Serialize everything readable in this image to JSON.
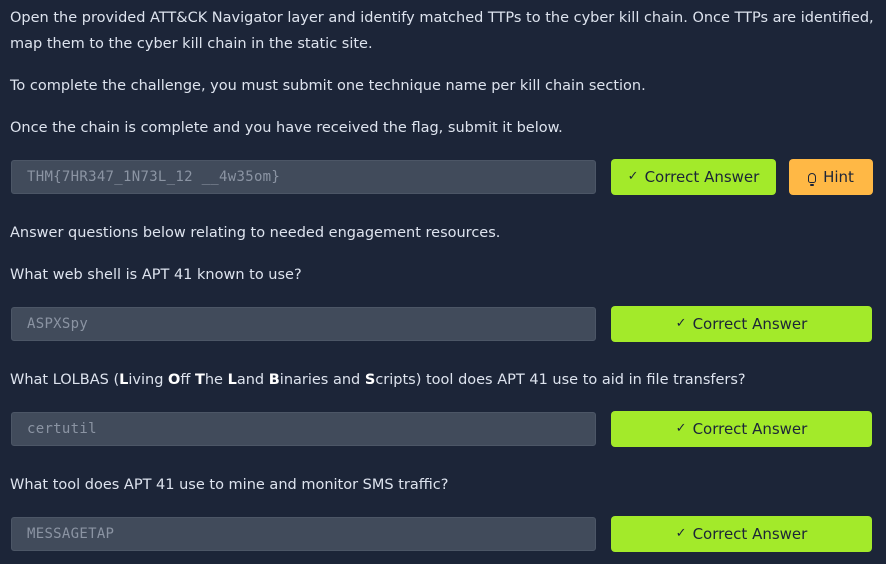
{
  "intro": {
    "paragraph1": "Open the provided ATT&CK Navigator layer and identify matched TTPs to the cyber kill chain. Once TTPs are identified, map them to the cyber kill chain in the static site.",
    "paragraph2": "To complete the challenge, you must submit one technique name per kill chain section.",
    "paragraph3": "Once the chain is complete and you have received the flag, submit it below."
  },
  "flag": {
    "value": "THM{7HR347_1N73L_12 __4w35om}",
    "correct_label": "Correct Answer",
    "hint_label": "Hint"
  },
  "resources_intro": "Answer questions below relating to needed engagement resources.",
  "questions": [
    {
      "text": "What web shell is APT 41 known to use?",
      "answer": "ASPXSpy",
      "button_label": "Correct Answer"
    },
    {
      "text_parts": [
        "What LOLBAS (",
        "L",
        "iving ",
        "O",
        "ff ",
        "T",
        "he ",
        "L",
        "and ",
        "B",
        "inaries and ",
        "S",
        "cripts) tool does APT 41 use to aid in file transfers?"
      ],
      "answer": "certutil",
      "button_label": "Correct Answer"
    },
    {
      "text": "What tool does APT 41 use to mine and monitor SMS traffic?",
      "answer": "MESSAGETAP",
      "button_label": "Correct Answer"
    }
  ],
  "icons": {
    "check": "check-icon",
    "hint": "lightbulb-icon"
  },
  "colors": {
    "background": "#1c2538",
    "correct_button": "#a3ea2a",
    "hint_button": "#ffb845",
    "input_background": "#414b5b"
  }
}
